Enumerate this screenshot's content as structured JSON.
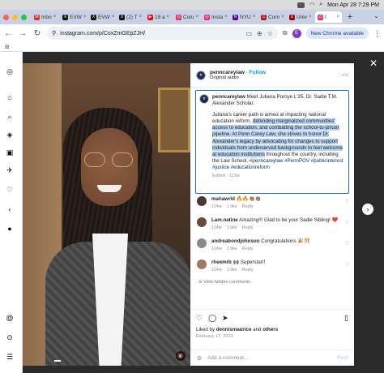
{
  "menubar": {
    "datetime": "Mon Apr 28  7:29 PM"
  },
  "tabs": [
    {
      "label": "Inbo",
      "color": "#d93025",
      "glyph": "M"
    },
    {
      "label": "EVW",
      "color": "#111111",
      "glyph": "X"
    },
    {
      "label": "EVW",
      "color": "#111111",
      "glyph": "X"
    },
    {
      "label": "(2) T",
      "color": "#111111",
      "glyph": "X"
    },
    {
      "label": "18 a",
      "color": "#ff0000",
      "glyph": "▶"
    },
    {
      "label": "Colu",
      "color": "#e1306c",
      "glyph": "◎"
    },
    {
      "label": "Insta",
      "color": "#e1306c",
      "glyph": "◎"
    },
    {
      "label": "NYU",
      "color": "#57068c",
      "glyph": "N"
    },
    {
      "label": "Corn",
      "color": "#b31b1b",
      "glyph": "C"
    },
    {
      "label": "Univ",
      "color": "#990000",
      "glyph": "U"
    },
    {
      "label": "I",
      "color": "#e1306c",
      "glyph": "◎"
    }
  ],
  "nav": {
    "url": "instagram.com/p/CoxZmGEpZJH/",
    "new_chrome": "New Chrome available",
    "profile_initial": "E"
  },
  "post": {
    "username": "penncareylaw",
    "follow": "Follow",
    "audio": "Original audio",
    "caption_user": "penncareylaw",
    "caption_intro": "Meet Juliana Poroye L'25, Dr. Sadie T.M. Alexander Scholar.",
    "caption_body_1": "Juliana's career path is aimed at impacting national education reform, ",
    "caption_highlight": "defending marginalized communities' access to education, and combatting the school-to-prison pipeline. At Penn Carey Law, she strives to honor Dr. Alexander's legacy by advocating for changes to support individuals from underserved backgrounds to feel welcome at education institutions",
    "caption_body_2": " throughout the country, including the Law School.",
    "hashtags": "#penncareylaw #PennPOV #publicinterest #justice #educationreform",
    "edited": "Edited · 113w",
    "hidden_comments": "View hidden comments",
    "liked_prefix": "Liked by ",
    "liked_user": "dennismaurice",
    "liked_suffix": " and ",
    "liked_others": "others",
    "date": "February 17, 2023",
    "add_comment": "Add a comment…",
    "post_btn": "Post"
  },
  "comments": [
    {
      "user": "mahawrld",
      "text": "🔥🔥👏🏽👏🏽",
      "age": "114w",
      "likes": "1 like",
      "reply": "Reply",
      "avatar": "#4a3a2e"
    },
    {
      "user": "Lam.natine",
      "text": "Amazing!!! Glad to be your Sadie Sibling! ❤️",
      "age": "114w",
      "likes": "1 like",
      "reply": "Reply",
      "avatar": "#6b4a3a"
    },
    {
      "user": "andreabondjohnson",
      "text": "Congratulations 🎉🎊",
      "age": "114w",
      "likes": "1 like",
      "reply": "Reply",
      "avatar": "#8a8a8a"
    },
    {
      "user": "rheemrb",
      "text": "🙌🏾 Superstar!!",
      "age": "114w",
      "likes": "1 like",
      "reply": "Reply",
      "avatar": "#a07a60"
    }
  ]
}
